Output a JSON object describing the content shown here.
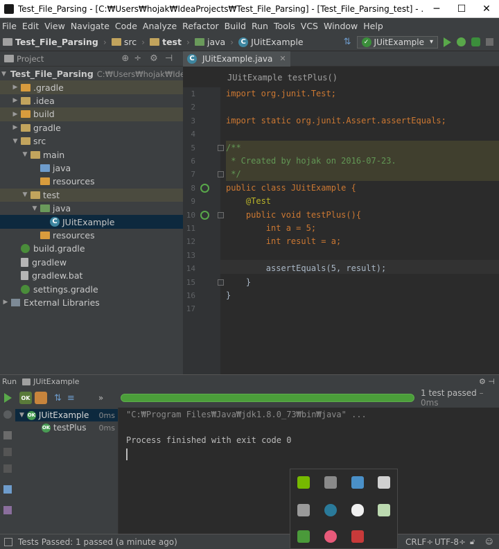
{
  "window": {
    "title": "Test_File_Parsing - [C:₩Users₩hojak₩IdeaProjects₩Test_File_Parsing] - [Test_File_Parsing_test] - ...₩src₩test₩j...",
    "minimize": "─",
    "maximize": "☐",
    "close": "✕"
  },
  "menu": [
    "File",
    "Edit",
    "View",
    "Navigate",
    "Code",
    "Analyze",
    "Refactor",
    "Build",
    "Run",
    "Tools",
    "VCS",
    "Window",
    "Help"
  ],
  "navbar": {
    "crumbs": [
      "Test_File_Parsing",
      "src",
      "test",
      "java",
      "JUitExample"
    ],
    "run_config": "JUitExample",
    "dropdown_arrow": "▾",
    "sort_glyph": "⇅"
  },
  "project": {
    "header": "Project",
    "header_icons": [
      "⊕",
      "÷",
      "⚙",
      "⊣"
    ],
    "tree": [
      {
        "label": "Test_File_Parsing",
        "hint": "C:₩Users₩hojak₩IdeaProjects₩Test_File_Parsing",
        "arrow": "▼",
        "icon": "folder-gray",
        "depth": 0
      },
      {
        "label": ".gradle",
        "arrow": "▶",
        "icon": "folder-orange",
        "depth": 1
      },
      {
        "label": ".idea",
        "arrow": "▶",
        "icon": "folder",
        "depth": 1
      },
      {
        "label": "build",
        "arrow": "▶",
        "icon": "folder-orange",
        "depth": 1
      },
      {
        "label": "gradle",
        "arrow": "▶",
        "icon": "folder",
        "depth": 1
      },
      {
        "label": "src",
        "arrow": "▼",
        "icon": "folder",
        "depth": 1
      },
      {
        "label": "main",
        "arrow": "▼",
        "icon": "folder",
        "depth": 2
      },
      {
        "label": "java",
        "arrow": "",
        "icon": "folder-blue",
        "depth": 3
      },
      {
        "label": "resources",
        "arrow": "",
        "icon": "folder-orange",
        "depth": 3
      },
      {
        "label": "test",
        "arrow": "▼",
        "icon": "folder",
        "depth": 2
      },
      {
        "label": "java",
        "arrow": "▼",
        "icon": "folder-green",
        "depth": 3
      },
      {
        "label": "JUitExample",
        "arrow": "",
        "icon": "java-class",
        "depth": 4
      },
      {
        "label": "resources",
        "arrow": "",
        "icon": "folder-orange",
        "depth": 3
      },
      {
        "label": "build.gradle",
        "arrow": "",
        "icon": "gradle",
        "depth": 1
      },
      {
        "label": "gradlew",
        "arrow": "",
        "icon": "file",
        "depth": 1
      },
      {
        "label": "gradlew.bat",
        "arrow": "",
        "icon": "file",
        "depth": 1
      },
      {
        "label": "settings.gradle",
        "arrow": "",
        "icon": "gradle",
        "depth": 1
      },
      {
        "label": "External Libraries",
        "arrow": "▶",
        "icon": "ext-lib",
        "depth": 0
      }
    ]
  },
  "editor": {
    "tab": "JUitExample.java",
    "tab_close": "✕",
    "breadcrumb": "JUitExample  testPlus()",
    "line_numbers": [
      "1",
      "2",
      "3",
      "4",
      "5",
      "6",
      "7",
      "8",
      "9",
      "10",
      "11",
      "12",
      "13",
      "14",
      "15",
      "16",
      "17"
    ],
    "code": [
      "import org.junit.Test;",
      "",
      "import static org.junit.Assert.assertEquals;",
      "",
      "/**",
      " * Created by hojak on 2016-07-23.",
      " */",
      "public class JUitExample {",
      "    @Test",
      "    public void testPlus(){",
      "        int a = 5;",
      "        int result = a;",
      "",
      "        assertEquals(5, result);",
      "    }",
      "}",
      ""
    ]
  },
  "run": {
    "header_label": "Run",
    "config": "JUitExample",
    "status": "1 test passed",
    "duration": "– 0ms",
    "more": "»",
    "tests": [
      {
        "name": "JUitExample",
        "time": "0ms"
      },
      {
        "name": "testPlus",
        "time": "0ms"
      }
    ],
    "console_cmd": "\"C:₩Program Files₩Java₩jdk1.8.0_73₩bin₩java\" ...",
    "console_exit": "Process finished with exit code 0",
    "progress": 1.0
  },
  "statusbar": {
    "message": "Tests Passed: 1 passed (a minute ago)",
    "line_sep": "CRLF÷",
    "encoding": "UTF-8÷"
  },
  "colors": {
    "accent_green": "#59a84a",
    "selection": "#0d293e",
    "keyword": "#cc7832"
  }
}
